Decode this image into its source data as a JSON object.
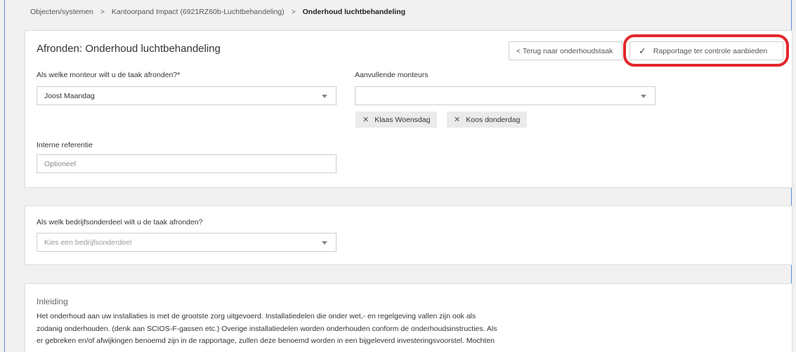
{
  "breadcrumb": {
    "items": [
      "Objecten/systemen",
      "Kantoorpand Impact (6921RZ60b-Luchtbehandeling)"
    ],
    "separator": ">",
    "current": "Onderhoud luchtbehandeling"
  },
  "finish_card": {
    "title": "Afronden: Onderhoud luchtbehandeling",
    "back_button": "< Terug naar onderhoudstaak",
    "submit_button": "Rapportage ter controle aanbieden",
    "mechanic_label": "Als welke monteur wilt u de taak afronden?*",
    "mechanic_value": "Joost Maandag",
    "additional_label": "Aanvullende monteurs",
    "additional_value": "",
    "chips": [
      "Klaas Woensdag",
      "Koos donderdag"
    ],
    "reference_label": "Interne referentie",
    "reference_placeholder": "Optioneel"
  },
  "department_card": {
    "label": "Als welk bedrijfsonderdeel wilt u de taak afronden?",
    "placeholder": "Kies een bedrijfsonderdeel"
  },
  "intro_card": {
    "title": "Inleiding",
    "lines": [
      "Het onderhoud aan uw installaties is met de grootste zorg uitgevoerd. Installatiedelen die onder wet,- en regelgeving vallen zijn ook als",
      "zodanig onderhouden. (denk aan SCIOS-F-gassen etc.) Overige installatiedelen worden onderhouden conform de onderhoudsinstructies. Als",
      "er gebreken en/of afwijkingen benoemd zijn in de rapportage, zullen deze benoemd worden in een bijgeleverd investeringsvoorstel. Mochten"
    ]
  },
  "colors": {
    "highlight": "#e3262b",
    "frame_border": "#5b8fd8"
  }
}
